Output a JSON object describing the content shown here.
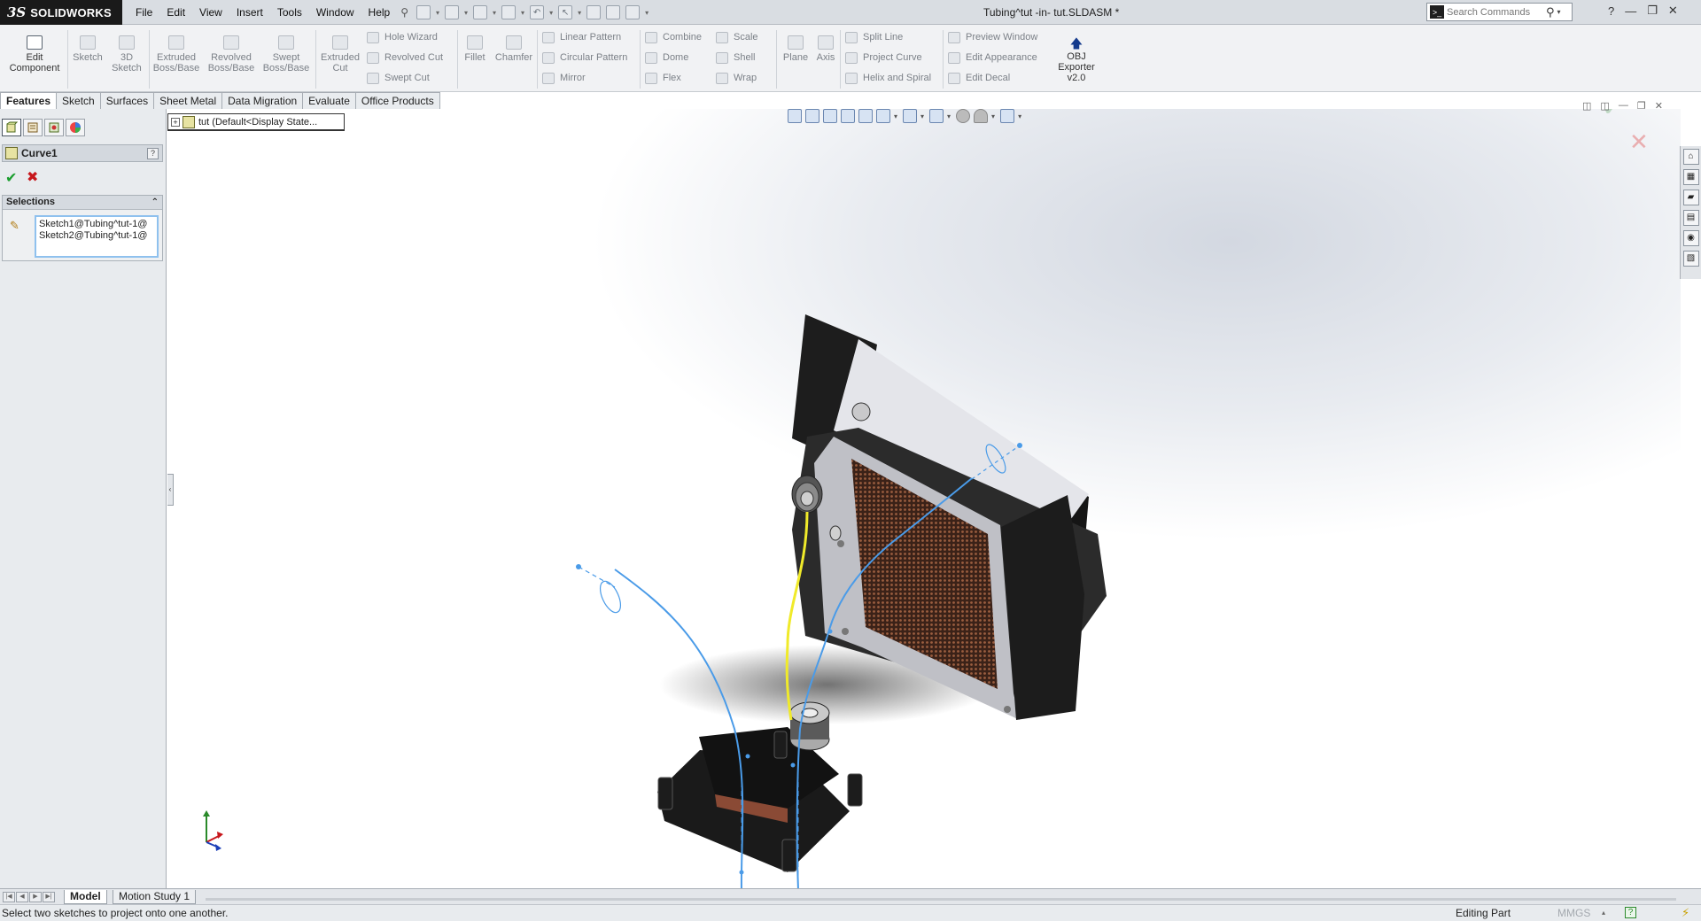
{
  "app": {
    "brand": "SOLIDWORKS",
    "menus": [
      "File",
      "Edit",
      "View",
      "Insert",
      "Tools",
      "Window",
      "Help"
    ],
    "document_title": "Tubing^tut -in- tut.SLDASM *"
  },
  "search": {
    "placeholder": "Search Commands"
  },
  "command_manager": {
    "big_buttons": [
      {
        "label": "Edit\nComponent",
        "active": true
      },
      {
        "label": "Sketch",
        "active": false
      },
      {
        "label": "3D\nSketch",
        "active": false
      },
      {
        "label": "Extruded\nBoss/Base",
        "active": false
      },
      {
        "label": "Revolved\nBoss/Base",
        "active": false
      },
      {
        "label": "Swept\nBoss/Base",
        "active": false
      },
      {
        "label": "Extruded\nCut",
        "active": false
      },
      {
        "label": "Fillet",
        "active": false
      },
      {
        "label": "Chamfer",
        "active": false
      },
      {
        "label": "Plane",
        "active": false
      },
      {
        "label": "Axis",
        "active": false
      },
      {
        "label": "OBJ\nExporter\nv2.0",
        "active": true
      }
    ],
    "small_buttons": [
      "Hole Wizard",
      "Revolved Cut",
      "Swept Cut",
      "Linear Pattern",
      "Circular Pattern",
      "Mirror",
      "Combine",
      "Dome",
      "Flex",
      "Scale",
      "Shell",
      "Wrap",
      "Split Line",
      "Project Curve",
      "Helix and Spiral",
      "Preview Window",
      "Edit Appearance",
      "Edit Decal"
    ]
  },
  "tabs": [
    "Features",
    "Sketch",
    "Surfaces",
    "Sheet Metal",
    "Data Migration",
    "Evaluate",
    "Office Products"
  ],
  "active_tab": "Features",
  "property_manager": {
    "title": "Curve1",
    "help": "?",
    "selections_header": "Selections",
    "selections": [
      "Sketch1@Tubing^tut-1@",
      "Sketch2@Tubing^tut-1@"
    ]
  },
  "feature_tree_flyout": {
    "label": "tut  (Default<Display State..."
  },
  "bottom_tabs": [
    "Model",
    "Motion Study 1"
  ],
  "active_bottom_tab": "Model",
  "status": {
    "message": "Select two sketches to project onto one another.",
    "mode": "Editing Part",
    "units": "MMGS",
    "help": "?"
  },
  "colors": {
    "sketch_blue": "#4a9be8",
    "tube_yellow": "#f0ea2a",
    "radiator_copper": "#7a4a33",
    "ok_green": "#1b9e2f",
    "cancel_red": "#c7171c"
  },
  "icons": {
    "ok": "check-icon",
    "cancel": "x-icon",
    "search": "magnifier-icon",
    "help": "question-icon"
  }
}
